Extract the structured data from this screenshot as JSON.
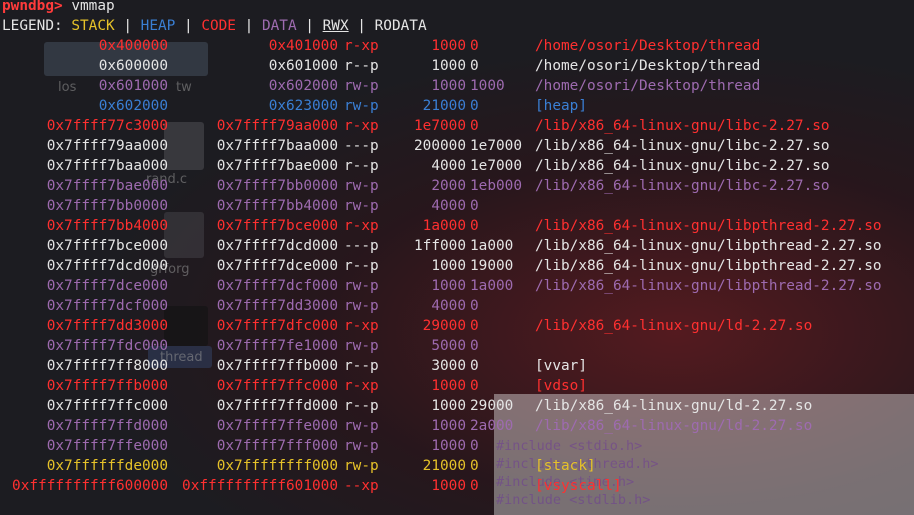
{
  "prompt": "pwndbg>",
  "command": "vmmap",
  "legend": {
    "label": "LEGEND:",
    "stack": "STACK",
    "heap": "HEAP",
    "code": "CODE",
    "data": "DATA",
    "rwx": "RWX",
    "rodata": "RODATA"
  },
  "colors": {
    "code": "#ff3030",
    "rodata": "#e5e5e5",
    "data": "#9e6bb0",
    "heap": "#3a7fd4",
    "stack": "#e6c229",
    "prompt": "#ff3b3b"
  },
  "mappings": [
    {
      "start": "0x400000",
      "end": "0x401000",
      "perm": "r-xp",
      "size": "1000",
      "offset": "0",
      "path": "/home/osori/Desktop/thread",
      "kind": "code"
    },
    {
      "start": "0x600000",
      "end": "0x601000",
      "perm": "r--p",
      "size": "1000",
      "offset": "0",
      "path": "/home/osori/Desktop/thread",
      "kind": "rodata"
    },
    {
      "start": "0x601000",
      "end": "0x602000",
      "perm": "rw-p",
      "size": "1000",
      "offset": "1000",
      "path": "/home/osori/Desktop/thread",
      "kind": "data"
    },
    {
      "start": "0x602000",
      "end": "0x623000",
      "perm": "rw-p",
      "size": "21000",
      "offset": "0",
      "path": "[heap]",
      "kind": "heap"
    },
    {
      "start": "0x7ffff77c3000",
      "end": "0x7ffff79aa000",
      "perm": "r-xp",
      "size": "1e7000",
      "offset": "0",
      "path": "/lib/x86_64-linux-gnu/libc-2.27.so",
      "kind": "code"
    },
    {
      "start": "0x7ffff79aa000",
      "end": "0x7ffff7baa000",
      "perm": "---p",
      "size": "200000",
      "offset": "1e7000",
      "path": "/lib/x86_64-linux-gnu/libc-2.27.so",
      "kind": "rodata"
    },
    {
      "start": "0x7ffff7baa000",
      "end": "0x7ffff7bae000",
      "perm": "r--p",
      "size": "4000",
      "offset": "1e7000",
      "path": "/lib/x86_64-linux-gnu/libc-2.27.so",
      "kind": "rodata"
    },
    {
      "start": "0x7ffff7bae000",
      "end": "0x7ffff7bb0000",
      "perm": "rw-p",
      "size": "2000",
      "offset": "1eb000",
      "path": "/lib/x86_64-linux-gnu/libc-2.27.so",
      "kind": "data"
    },
    {
      "start": "0x7ffff7bb0000",
      "end": "0x7ffff7bb4000",
      "perm": "rw-p",
      "size": "4000",
      "offset": "0",
      "path": "",
      "kind": "data"
    },
    {
      "start": "0x7ffff7bb4000",
      "end": "0x7ffff7bce000",
      "perm": "r-xp",
      "size": "1a000",
      "offset": "0",
      "path": "/lib/x86_64-linux-gnu/libpthread-2.27.so",
      "kind": "code"
    },
    {
      "start": "0x7ffff7bce000",
      "end": "0x7ffff7dcd000",
      "perm": "---p",
      "size": "1ff000",
      "offset": "1a000",
      "path": "/lib/x86_64-linux-gnu/libpthread-2.27.so",
      "kind": "rodata"
    },
    {
      "start": "0x7ffff7dcd000",
      "end": "0x7ffff7dce000",
      "perm": "r--p",
      "size": "1000",
      "offset": "19000",
      "path": "/lib/x86_64-linux-gnu/libpthread-2.27.so",
      "kind": "rodata"
    },
    {
      "start": "0x7ffff7dce000",
      "end": "0x7ffff7dcf000",
      "perm": "rw-p",
      "size": "1000",
      "offset": "1a000",
      "path": "/lib/x86_64-linux-gnu/libpthread-2.27.so",
      "kind": "data"
    },
    {
      "start": "0x7ffff7dcf000",
      "end": "0x7ffff7dd3000",
      "perm": "rw-p",
      "size": "4000",
      "offset": "0",
      "path": "",
      "kind": "data"
    },
    {
      "start": "0x7ffff7dd3000",
      "end": "0x7ffff7dfc000",
      "perm": "r-xp",
      "size": "29000",
      "offset": "0",
      "path": "/lib/x86_64-linux-gnu/ld-2.27.so",
      "kind": "code"
    },
    {
      "start": "0x7ffff7fdc000",
      "end": "0x7ffff7fe1000",
      "perm": "rw-p",
      "size": "5000",
      "offset": "0",
      "path": "",
      "kind": "data"
    },
    {
      "start": "0x7ffff7ff8000",
      "end": "0x7ffff7ffb000",
      "perm": "r--p",
      "size": "3000",
      "offset": "0",
      "path": "[vvar]",
      "kind": "rodata"
    },
    {
      "start": "0x7ffff7ffb000",
      "end": "0x7ffff7ffc000",
      "perm": "r-xp",
      "size": "1000",
      "offset": "0",
      "path": "[vdso]",
      "kind": "code"
    },
    {
      "start": "0x7ffff7ffc000",
      "end": "0x7ffff7ffd000",
      "perm": "r--p",
      "size": "1000",
      "offset": "29000",
      "path": "/lib/x86_64-linux-gnu/ld-2.27.so",
      "kind": "rodata"
    },
    {
      "start": "0x7ffff7ffd000",
      "end": "0x7ffff7ffe000",
      "perm": "rw-p",
      "size": "1000",
      "offset": "2a000",
      "path": "/lib/x86_64-linux-gnu/ld-2.27.so",
      "kind": "data"
    },
    {
      "start": "0x7ffff7ffe000",
      "end": "0x7ffff7fff000",
      "perm": "rw-p",
      "size": "1000",
      "offset": "0",
      "path": "",
      "kind": "data"
    },
    {
      "start": "0x7ffffffde000",
      "end": "0x7ffffffff000",
      "perm": "rw-p",
      "size": "21000",
      "offset": "0",
      "path": "[stack]",
      "kind": "stack"
    },
    {
      "start": "0xffffffffff600000",
      "end": "0xffffffffff601000",
      "perm": "--xp",
      "size": "1000",
      "offset": "0",
      "path": "[vsyscall]",
      "kind": "code"
    }
  ],
  "background": {
    "desktop_labels": [
      "los",
      "tw",
      "rand.c",
      "grforg",
      "thread"
    ],
    "editor_lines": [
      "#include <stdio.h>",
      "#include <pthread.h>",
      "#include <time.h>",
      "#include <stdlib.h>"
    ]
  }
}
